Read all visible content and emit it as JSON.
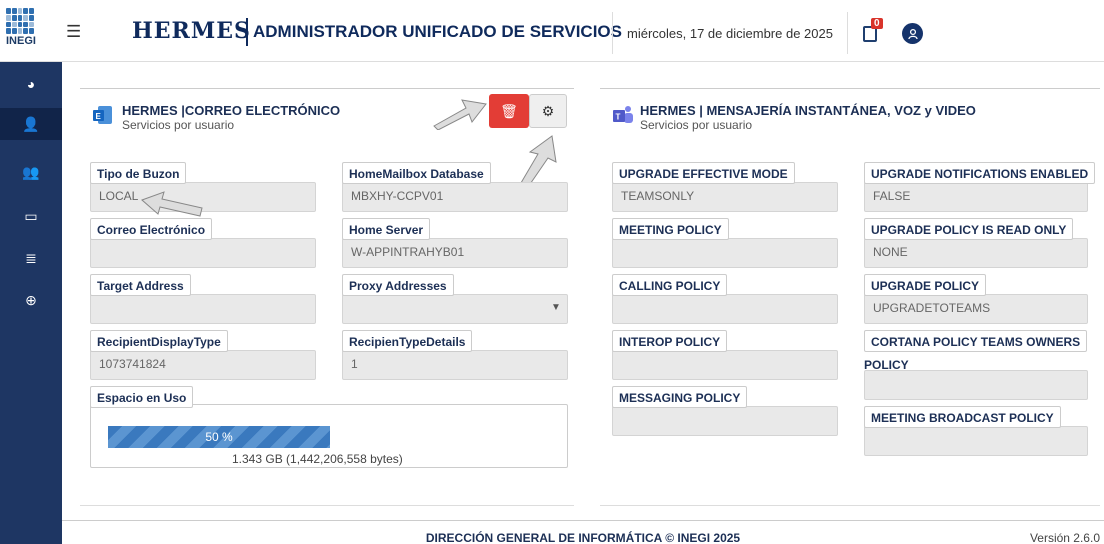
{
  "header": {
    "logo_text": "INEGI",
    "brand": "HERMES",
    "subtitle": "ADMINISTRADOR UNIFICADO DE SERVICIOS",
    "date": "miércoles, 17 de diciembre de 2025",
    "notif_count": "0",
    "user_icon": "user-icon",
    "menu_icon": "☰"
  },
  "sidebar": {
    "items": [
      {
        "name": "dashboard-icon",
        "glyph": "◕"
      },
      {
        "name": "add-user-icon",
        "glyph": "👤"
      },
      {
        "name": "users-icon",
        "glyph": "👥"
      },
      {
        "name": "monitor-icon",
        "glyph": "▭"
      },
      {
        "name": "list-icon",
        "glyph": "≣"
      },
      {
        "name": "search-plus-icon",
        "glyph": "⊕"
      }
    ]
  },
  "left_panel": {
    "title": "HERMES |CORREO ELECTRÓNICO",
    "subtitle": "Servicios por usuario",
    "fields": {
      "tipo_buzon": {
        "label": "Tipo de Buzon",
        "value": "LOCAL"
      },
      "home_mailbox_db": {
        "label": "HomeMailbox Database",
        "value": "MBXHY-CCPV01"
      },
      "correo": {
        "label": "Correo Electrónico",
        "value": ""
      },
      "home_server": {
        "label": "Home Server",
        "value": "W-APPINTRAHYB01"
      },
      "target_address": {
        "label": "Target Address",
        "value": ""
      },
      "proxy_addresses": {
        "label": "Proxy Addresses",
        "value": ""
      },
      "recipient_display_type": {
        "label": "RecipientDisplayType",
        "value": "1073741824"
      },
      "recipient_type_details": {
        "label": "RecipienTypeDetails",
        "value": "1"
      },
      "espacio": {
        "label": "Espacio en Uso"
      }
    },
    "usage": {
      "percent_label": "50 %",
      "percent": 0.5,
      "bytes": "1.343 GB (1,442,206,558 bytes)"
    }
  },
  "right_panel": {
    "title": "HERMES | MENSAJERÍA INSTANTÁNEA, VOZ y VIDEO",
    "subtitle": "Servicios por usuario",
    "fields": {
      "upgrade_effective_mode": {
        "label": "UPGRADE EFFECTIVE MODE",
        "value": "TEAMSONLY"
      },
      "upgrade_notifications": {
        "label": "UPGRADE NOTIFICATIONS ENABLED",
        "value": "FALSE"
      },
      "meeting_policy": {
        "label": "MEETING POLICY",
        "value": ""
      },
      "upgrade_policy_read_only": {
        "label": "UPGRADE POLICY IS READ ONLY",
        "value": "NONE"
      },
      "calling_policy": {
        "label": "CALLING POLICY",
        "value": ""
      },
      "upgrade_policy": {
        "label": "UPGRADE POLICY",
        "value": "UPGRADETOTEAMS"
      },
      "interop_policy": {
        "label": "INTEROP POLICY",
        "value": ""
      },
      "cortana_policy": {
        "label": "CORTANA POLICY TEAMS OWNERS",
        "label2": "POLICY",
        "value": ""
      },
      "messaging_policy": {
        "label": "MESSAGING POLICY",
        "value": ""
      },
      "meeting_broadcast_policy": {
        "label": "MEETING BROADCAST POLICY",
        "value": ""
      }
    }
  },
  "footer": {
    "center": "DIRECCIÓN GENERAL DE INFORMÁTICA © INEGI 2025",
    "version": "Versión  2.6.0"
  },
  "colors": {
    "sidebar": "#1e3663",
    "accent": "#0f2a5c",
    "delete": "#e33d36",
    "progress": "#3a79be"
  }
}
